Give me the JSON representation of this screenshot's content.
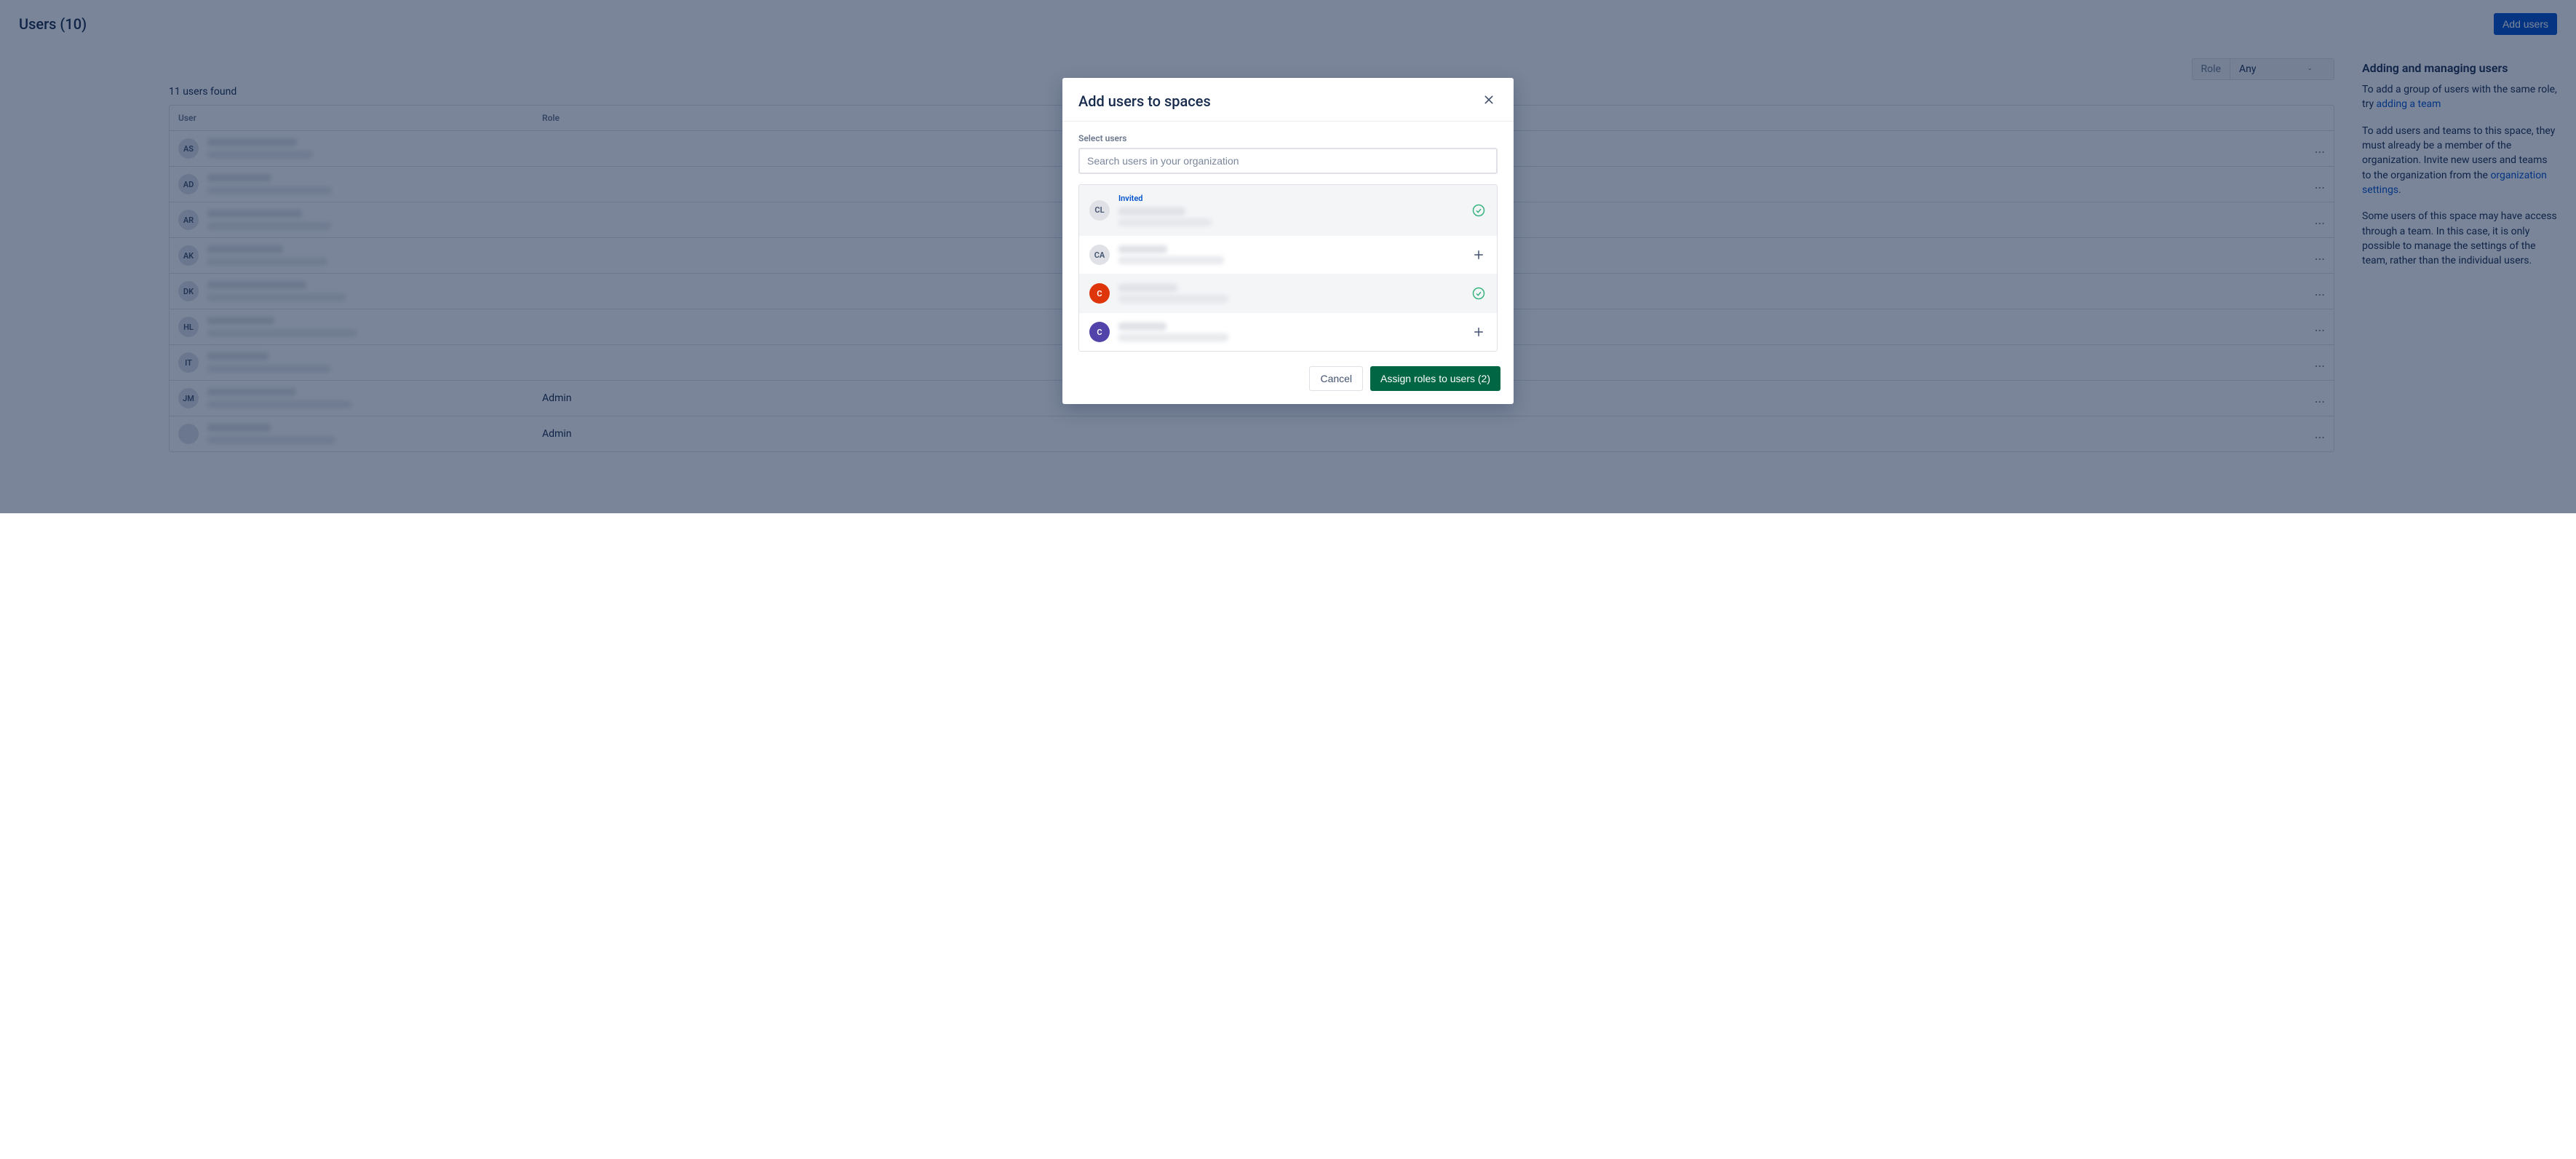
{
  "header": {
    "title": "Users (10)",
    "add_btn": "Add users"
  },
  "filter": {
    "label": "Role",
    "value": "Any"
  },
  "count": "11 users found",
  "columns": {
    "user": "User",
    "role": "Role"
  },
  "rows": [
    {
      "initials": "AS",
      "role": ""
    },
    {
      "initials": "AD",
      "role": ""
    },
    {
      "initials": "AR",
      "role": ""
    },
    {
      "initials": "AK",
      "role": ""
    },
    {
      "initials": "DK",
      "role": ""
    },
    {
      "initials": "HL",
      "role": ""
    },
    {
      "initials": "IT",
      "role": ""
    },
    {
      "initials": "JM",
      "role": "Admin"
    },
    {
      "initials": "",
      "role": "Admin"
    }
  ],
  "side": {
    "heading": "Adding and managing users",
    "p1a": "To add a group of users with the same role, try ",
    "p1link": "adding a team",
    "p2a": "To add users and teams to this space, they must already be a member of the organization. Invite new users and teams to the organization from the ",
    "p2link": "organization settings",
    "p2b": ".",
    "p3": "Some users of this space may have access through a team. In this case, it is only possible to manage the settings of the team, rather than the individual users."
  },
  "dialog": {
    "title": "Add users to spaces",
    "field_label": "Select users",
    "search_placeholder": "Search users in your organization",
    "invited_label": "Invited",
    "users": [
      {
        "initials": "CL",
        "avatar_class": "avatar-grey",
        "selected": true,
        "invited": true
      },
      {
        "initials": "CA",
        "avatar_class": "avatar-grey",
        "selected": false,
        "invited": false
      },
      {
        "initials": "C",
        "avatar_class": "avatar-red",
        "selected": true,
        "invited": false
      },
      {
        "initials": "C",
        "avatar_class": "avatar-purple",
        "selected": false,
        "invited": false
      }
    ],
    "cancel": "Cancel",
    "assign": "Assign roles to users (2)"
  },
  "actions_dots": "..."
}
